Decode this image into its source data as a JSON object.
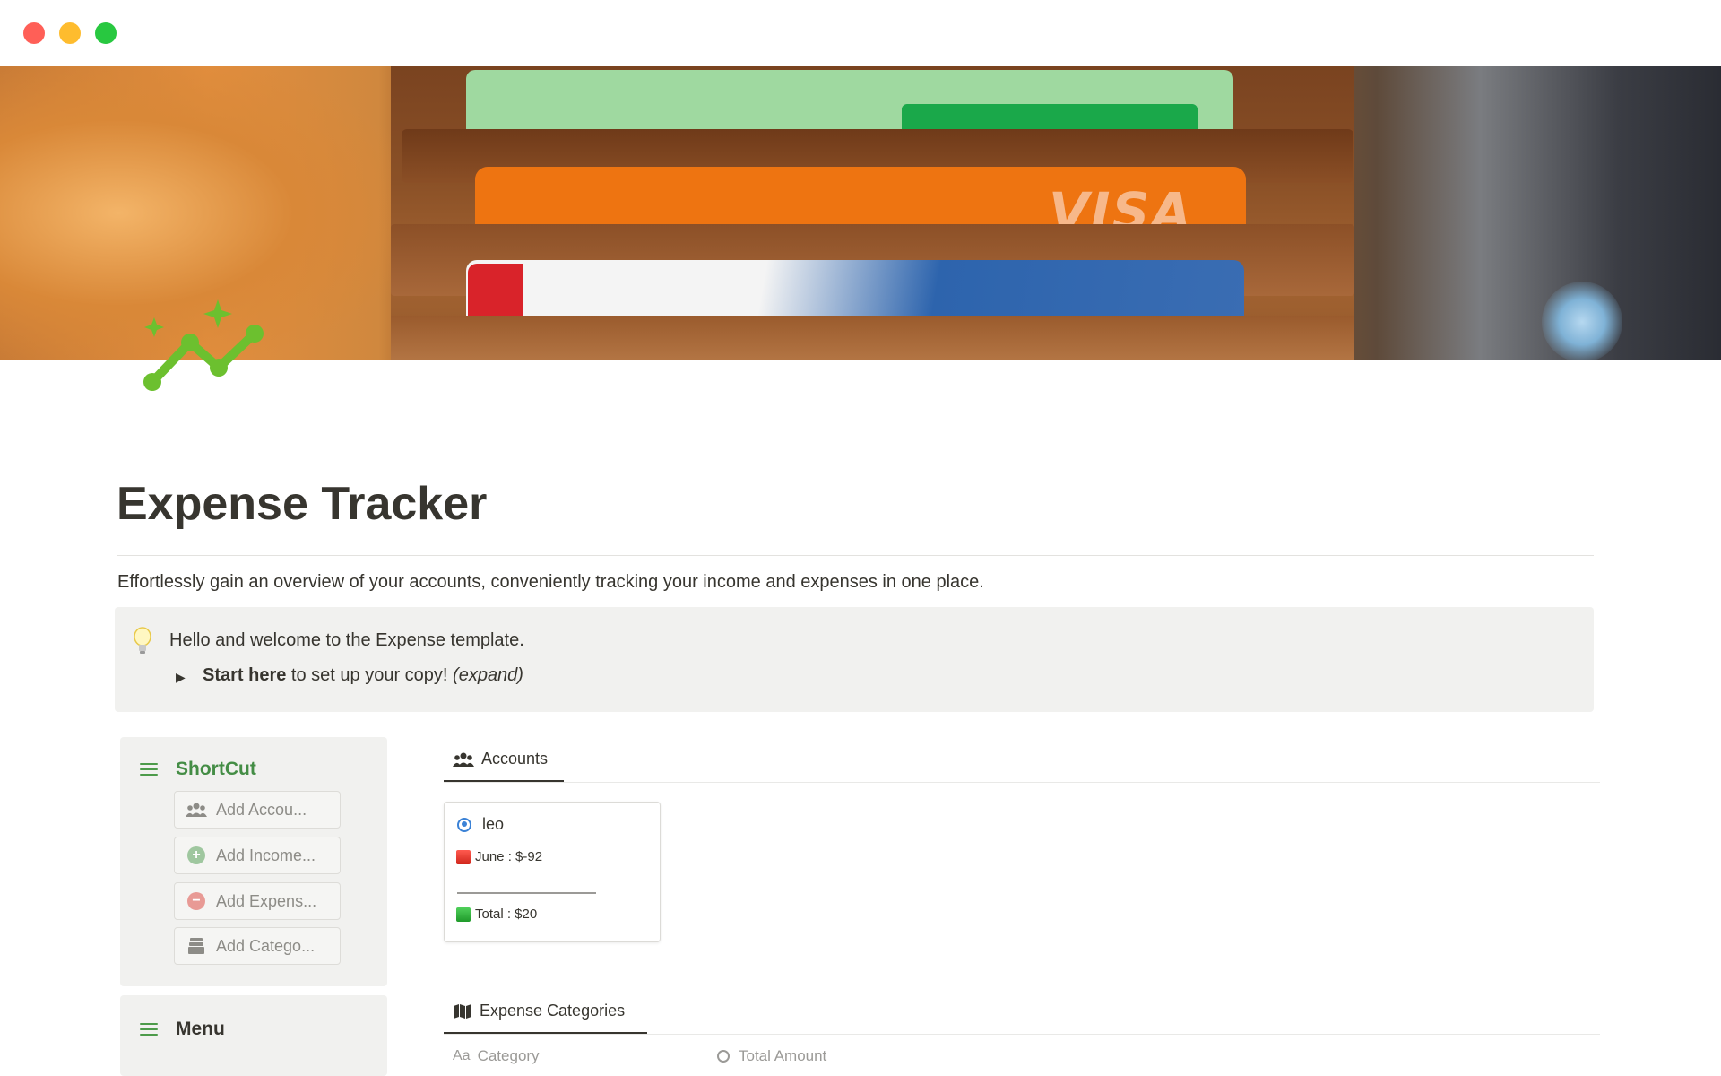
{
  "page": {
    "title": "Expense Tracker",
    "description": "Effortlessly gain an overview of your accounts, conveniently tracking your income and expenses in one place.",
    "icon": "trend-sparkle-icon",
    "accent_color": "#448d45"
  },
  "callout": {
    "icon": "lightbulb-icon",
    "line1": "Hello and welcome to the Expense template.",
    "toggle_bold": "Start here",
    "toggle_text": " to set up your copy! ",
    "toggle_italic": "(expand)"
  },
  "shortcut": {
    "title": "ShortCut",
    "buttons": [
      {
        "label": "Add Accou...",
        "icon": "people-icon"
      },
      {
        "label": "Add Income...",
        "icon": "plus-circle-icon",
        "color": "#9fc79f"
      },
      {
        "label": "Add Expens...",
        "icon": "minus-circle-icon",
        "color": "#e89a95"
      },
      {
        "label": "Add Catego...",
        "icon": "archive-icon"
      }
    ]
  },
  "menu": {
    "title": "Menu"
  },
  "accounts_view": {
    "tab_label": "Accounts",
    "card": {
      "name": "leo",
      "month_line": "June : $-92",
      "rule": "———————————",
      "total_line": "Total : $20"
    }
  },
  "categories_view": {
    "tab_label": "Expense Categories",
    "columns": [
      "Category",
      "Total Amount"
    ]
  }
}
